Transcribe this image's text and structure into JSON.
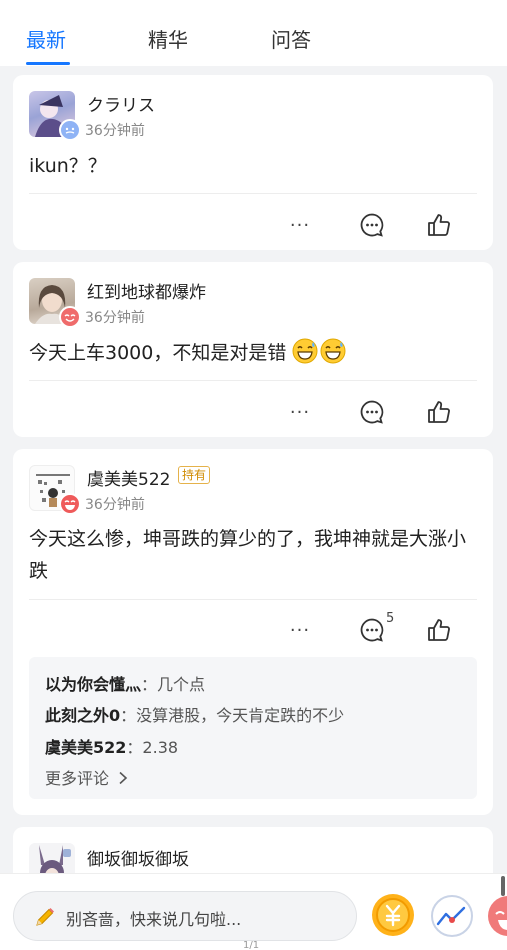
{
  "tabs": [
    {
      "label": "最新",
      "active": true
    },
    {
      "label": "精华",
      "active": false
    },
    {
      "label": "问答",
      "active": false
    }
  ],
  "posts": [
    {
      "username": "クラリス",
      "time": "36分钟前",
      "content": "ikun？？"
    },
    {
      "username": "红到地球都爆炸",
      "time": "36分钟前",
      "content": "今天上车3000，不知是对是错"
    },
    {
      "username": "虞美美522",
      "badge": "持有",
      "time": "36分钟前",
      "content": "今天这么惨，坤哥跌的算少的了，我坤神就是大涨小跌",
      "comment_count": "5",
      "comments": [
        {
          "name": "以为你会懂灬",
          "text": "几个点"
        },
        {
          "name": "此刻之外0",
          "text": "没算港股，今天肯定跌的不少"
        },
        {
          "name": "虞美美522",
          "text": "2.38"
        }
      ],
      "more_comments": "更多评论"
    },
    {
      "username": "御坂御坂御坂"
    }
  ],
  "actions": {
    "more": "···"
  },
  "bottom": {
    "placeholder": "别吝啬，快来说几句啦...",
    "page_indicator": "1/1"
  },
  "colors": {
    "accent": "#1677ff",
    "gold": "#f5a100",
    "reaction_red": "#ef5a5a"
  }
}
